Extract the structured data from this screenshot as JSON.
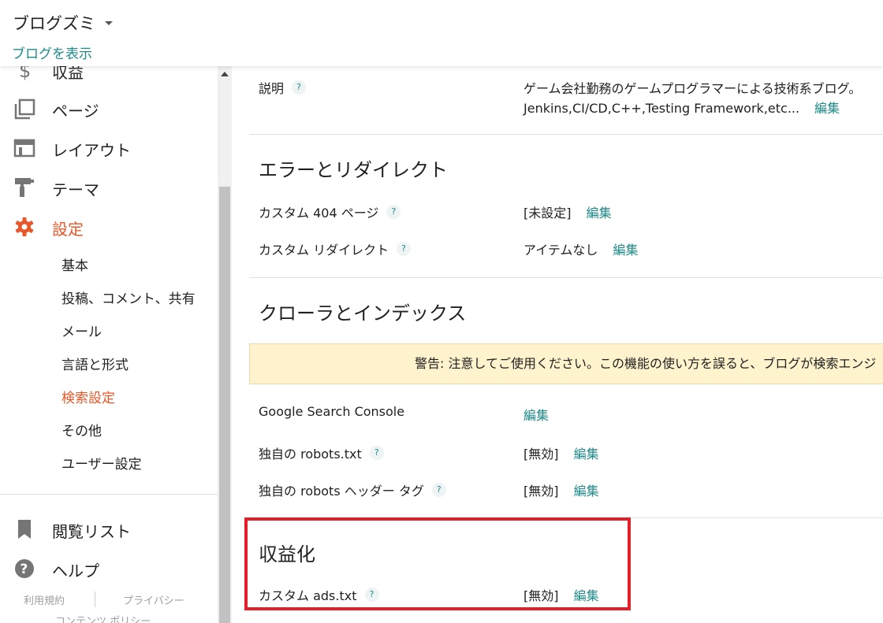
{
  "header": {
    "blog_title": "ブログズミ",
    "view_blog": "ブログを表示"
  },
  "sidebar": {
    "nav": [
      {
        "label": "収益",
        "icon": "dollar-icon"
      },
      {
        "label": "ページ",
        "icon": "pages-icon"
      },
      {
        "label": "レイアウト",
        "icon": "layout-icon"
      },
      {
        "label": "テーマ",
        "icon": "paint-roller-icon"
      },
      {
        "label": "設定",
        "icon": "gear-icon"
      }
    ],
    "sub_items": [
      "基本",
      "投稿、コメント、共有",
      "メール",
      "言語と形式",
      "検索設定",
      "その他",
      "ユーザー設定"
    ],
    "bottom_nav": [
      {
        "label": "閲覧リスト",
        "icon": "bookmark-icon"
      },
      {
        "label": "ヘルプ",
        "icon": "help-circle-icon"
      }
    ],
    "footer": {
      "terms": "利用規約",
      "privacy": "プライバシー",
      "content_policy": "コンテンツ ポリシー"
    }
  },
  "main": {
    "help_glyph": "?",
    "edit_label": "編集",
    "description": {
      "label": "説明",
      "line1": "ゲーム会社勤務のゲームプログラマーによる技術系ブログ。",
      "line2": "Jenkins,CI/CD,C++,Testing Framework,etc..."
    },
    "errors": {
      "title": "エラーとリダイレクト",
      "custom404_label": "カスタム 404 ページ",
      "custom404_value": "[未設定]",
      "redirect_label": "カスタム リダイレクト",
      "redirect_value": "アイテムなし"
    },
    "crawl": {
      "title": "クローラとインデックス",
      "warning": "警告: 注意してご使用ください。この機能の使い方を誤ると、ブログが検索エンジ",
      "gsc_label": "Google Search Console",
      "robots_label": "独自の robots.txt",
      "robots_value": "[無効]",
      "robots_header_label": "独自の robots ヘッダー タグ",
      "robots_header_value": "[無効]"
    },
    "monetization": {
      "title": "収益化",
      "ads_label": "カスタム ads.txt",
      "ads_value": "[無効]"
    }
  },
  "colors": {
    "accent": "#e8572a",
    "link": "#1e8a8a",
    "highlight": "#e3202a",
    "warning_bg": "#fff3cd"
  }
}
